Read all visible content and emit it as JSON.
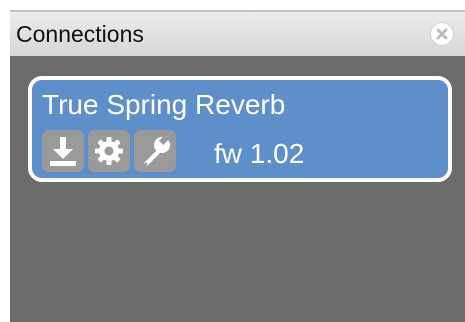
{
  "panel": {
    "title": "Connections",
    "close_icon": "close-icon"
  },
  "device": {
    "name": "True Spring Reverb",
    "firmware": "fw 1.02",
    "actions": [
      {
        "icon": "download-icon"
      },
      {
        "icon": "gear-icon"
      },
      {
        "icon": "wrench-icon"
      }
    ]
  },
  "colors": {
    "panel_background": "#6b6b6b",
    "header_background": "#e3e3e3",
    "card_background": "#5f8fc8",
    "card_border": "#ffffff",
    "icon_button_background": "#9a9a9a"
  }
}
